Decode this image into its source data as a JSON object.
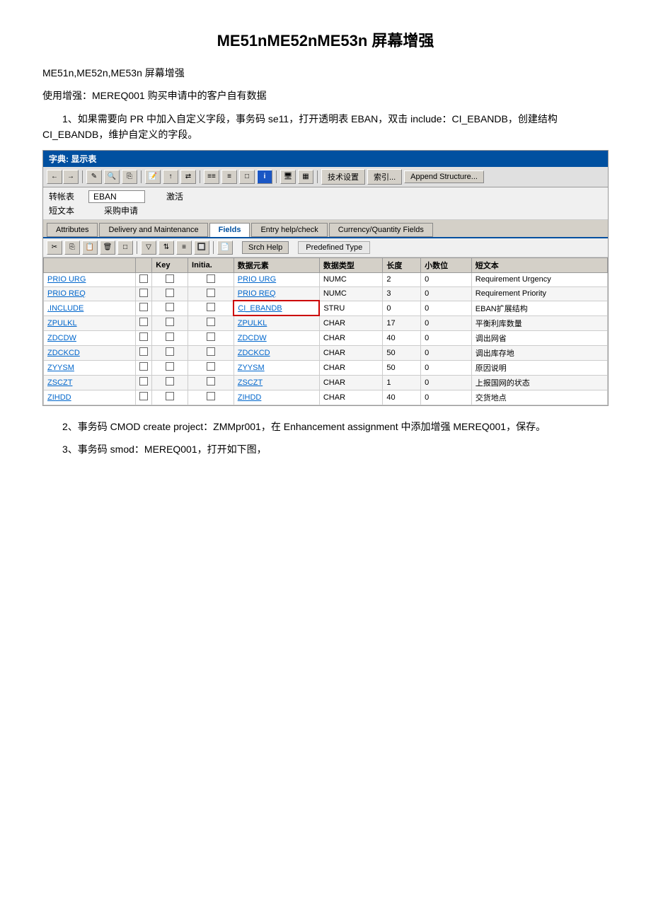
{
  "title": "ME51nME52nME53n 屏幕增强",
  "paragraphs": {
    "p1": "ME51n,ME52n,ME53n 屏幕增强",
    "p2": "使用增强：MEREQ001 购买申请中的客户自有数据",
    "p3": "1、如果需要向 PR 中加入自定义字段，事务码 se11，打开透明表 EBAN，双击 include：CI_EBANDB，创建结构 CI_EBANDB，维护自定义的字段。",
    "p4": "2、事务码 CMOD create project：ZMMpr001，在 Enhancement assignment 中添加增强 MEREQ001，保存。",
    "p5": "3、事务码 smod：MEREQ001，打开如下图，"
  },
  "dict": {
    "title": "字典: 显示表",
    "toolbar": {
      "buttons": [
        "←",
        "→",
        "✏",
        "🔍",
        "📋",
        "📝",
        "↑",
        "⇄",
        "品",
        "品",
        "□",
        "ℹ",
        "🖥",
        "▦",
        "技术设置",
        "索引...",
        "Append Structure..."
      ]
    },
    "fields": {
      "label1": "转帐表",
      "value1": "EBAN",
      "status1": "激活",
      "label2": "短文本",
      "value2": "采购申请"
    },
    "tabs": [
      "Attributes",
      "Delivery and Maintenance",
      "Fields",
      "Entry help/check",
      "Currency/Quantity Fields"
    ],
    "active_tab": "Fields",
    "table": {
      "headers": [
        "",
        "Key",
        "Initia.",
        "数据元素",
        "数据类型",
        "长度",
        "小数位",
        "短文本"
      ],
      "rows": [
        {
          "name": "PRIO URG",
          "key": false,
          "init": false,
          "element": "PRIO URG",
          "type": "NUMC",
          "len": "2",
          "dec": "0",
          "text": "Requirement Urgency",
          "highlight": false
        },
        {
          "name": "PRIO REQ",
          "key": false,
          "init": false,
          "element": "PRIO REQ",
          "type": "NUMC",
          "len": "3",
          "dec": "0",
          "text": "Requirement Priority",
          "highlight": false
        },
        {
          "name": ".INCLUDE",
          "key": false,
          "init": false,
          "element": "CI_EBANDB",
          "type": "STRU",
          "len": "0",
          "dec": "0",
          "text": "EBAN扩展结构",
          "highlight": true
        },
        {
          "name": "ZPULKL",
          "key": false,
          "init": false,
          "element": "ZPULKL",
          "type": "CHAR",
          "len": "17",
          "dec": "0",
          "text": "平衡利库数量",
          "highlight": false
        },
        {
          "name": "ZDCDW",
          "key": false,
          "init": false,
          "element": "ZDCDW",
          "type": "CHAR",
          "len": "40",
          "dec": "0",
          "text": "调出网省",
          "highlight": false
        },
        {
          "name": "ZDCKCD",
          "key": false,
          "init": false,
          "element": "ZDCKCD",
          "type": "CHAR",
          "len": "50",
          "dec": "0",
          "text": "调出库存地",
          "highlight": false
        },
        {
          "name": "ZYYSM",
          "key": false,
          "init": false,
          "element": "ZYYSM",
          "type": "CHAR",
          "len": "50",
          "dec": "0",
          "text": "原因说明",
          "highlight": false
        },
        {
          "name": "ZSCZT",
          "key": false,
          "init": false,
          "element": "ZSCZT",
          "type": "CHAR",
          "len": "1",
          "dec": "0",
          "text": "上报国网的状态",
          "highlight": false
        },
        {
          "name": "ZIHDD",
          "key": false,
          "init": false,
          "element": "ZIHDD",
          "type": "CHAR",
          "len": "40",
          "dec": "0",
          "text": "交货地点",
          "highlight": false
        }
      ]
    }
  }
}
